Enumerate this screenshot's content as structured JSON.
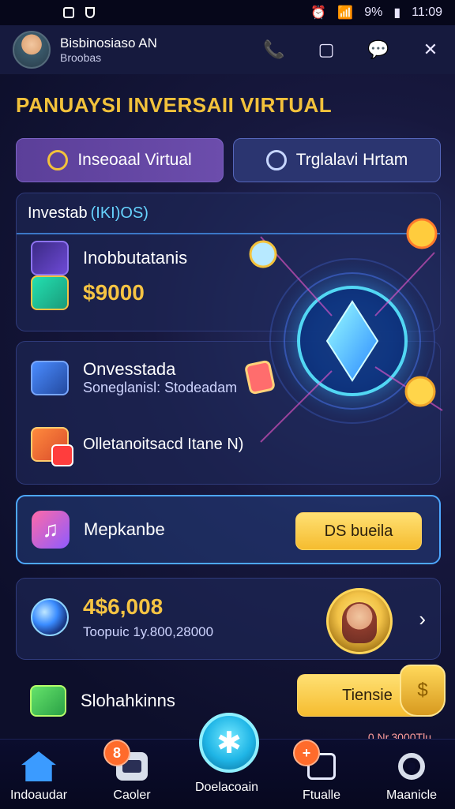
{
  "status_bar": {
    "battery": "9%",
    "time": "11:09"
  },
  "header": {
    "profile_name": "Bisbinosiaso AN",
    "profile_sub": "Broobas"
  },
  "page_title": "PANUAYSI INVERSAII VIRTUAL",
  "tabs": [
    {
      "label": "Inseoaal Virtual"
    },
    {
      "label": "Trglalavi Hrtam"
    }
  ],
  "investment_card": {
    "header_text": "Investab",
    "header_accent": "(IKI)OS)",
    "row1_title": "Inobbutatanis",
    "row1_value": "$9000"
  },
  "activity_card": {
    "item1_title": "Onvesstada",
    "item1_subtitle": "Soneglanisl: Stodeadam",
    "item2_title": "Olletanoitsacd Itane N)"
  },
  "mepkanbe_card": {
    "label": "Mepkanbe",
    "button_label": "DS bueila"
  },
  "balance_card": {
    "amount": "4$6,008",
    "subtitle": "Toopuic 1y.800,28000"
  },
  "bottom_row": {
    "label": "Slohahkinns",
    "button_label": "Tiensie",
    "small_text": "0 Nr.3000Tlu"
  },
  "bottom_nav": {
    "items": [
      {
        "label": "Indoaudar"
      },
      {
        "label": "Caoler",
        "badge": "8"
      },
      {
        "label": "Doelacoain"
      },
      {
        "label": "Ftualle",
        "badge": "+"
      },
      {
        "label": "Maanicle"
      }
    ]
  },
  "colors": {
    "accent_gold": "#f3c23b",
    "accent_blue": "#67d3ff"
  },
  "icons": [
    "phone-icon",
    "square-icon",
    "chat-icon",
    "close-icon",
    "home-icon",
    "calendar-icon",
    "star-icon",
    "tablet-icon",
    "gear-icon"
  ]
}
